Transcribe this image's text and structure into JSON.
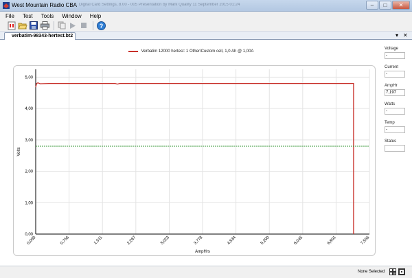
{
  "window": {
    "title": "West Mountain Radio CBA",
    "ghost_title": "Digital Card Settings, 8.00 - 005 Presentation by Mark Quality 11 September 2015 01:24",
    "controls": [
      "–",
      "□",
      "✕"
    ]
  },
  "menu": [
    "File",
    "Test",
    "Tools",
    "Window",
    "Help"
  ],
  "toolbar": {
    "icons": [
      "new-test-icon",
      "open-icon",
      "save-icon",
      "print-icon",
      "copy-icon",
      "run-icon",
      "stop-icon",
      "help-icon"
    ]
  },
  "tab": {
    "label": "verbatim-98343-hertest.bt2",
    "dropdown": "▾",
    "close": "✕"
  },
  "legend": {
    "label": "Verbatim 12000 hertest: 1 Other/Custom cell, 1,0 Ah @ 1,00A",
    "color": "#c8302a"
  },
  "side_panel": [
    {
      "label": "Voltage",
      "value": "-"
    },
    {
      "label": "Current",
      "value": "-"
    },
    {
      "label": "AmpHr",
      "value": "7,197"
    },
    {
      "label": "Watts",
      "value": "-"
    },
    {
      "label": "Temp",
      "value": "-"
    },
    {
      "label": "Status",
      "value": ""
    }
  ],
  "status": {
    "text": "None Selected"
  },
  "chart_data": {
    "type": "line",
    "xlabel": "AmpHrs",
    "ylabel": "Volts",
    "xlim": [
      0,
      7.556
    ],
    "ylim": [
      0,
      5.25
    ],
    "x_tick_labels": [
      "0,000",
      "0,756",
      "1,511",
      "2,267",
      "3,023",
      "3,778",
      "4,534",
      "5,290",
      "6,045",
      "6,801",
      "7,556"
    ],
    "y_tick_labels": [
      "0,00",
      "1,00",
      "2,00",
      "3,00",
      "4,00",
      "5,00"
    ],
    "x_ticks": [
      0,
      0.756,
      1.511,
      2.267,
      3.023,
      3.778,
      4.534,
      5.29,
      6.045,
      6.801,
      7.556
    ],
    "y_ticks": [
      0,
      1,
      2,
      3,
      4,
      5
    ],
    "grid": true,
    "series": [
      {
        "name": "Verbatim 12000 hertest: 1 Other/Custom cell, 1,0 Ah @ 1,00A",
        "color": "#c8302a",
        "x": [
          0,
          0.02,
          0.05,
          0.1,
          0.3,
          1.0,
          1.8,
          1.85,
          1.9,
          3.0,
          5.0,
          6.5,
          7.19,
          7.197,
          7.197
        ],
        "y": [
          4.68,
          4.8,
          4.82,
          4.79,
          4.8,
          4.8,
          4.8,
          4.78,
          4.8,
          4.8,
          4.8,
          4.8,
          4.8,
          4.8,
          0
        ]
      },
      {
        "color": "#3a9a3a",
        "dashed": true,
        "x": [
          0,
          7.556
        ],
        "y": [
          2.8,
          2.8
        ]
      }
    ]
  }
}
